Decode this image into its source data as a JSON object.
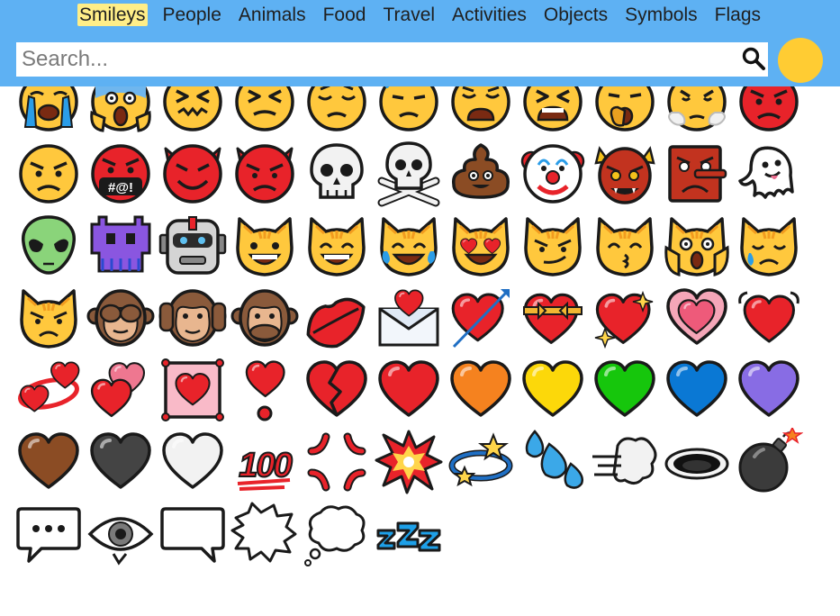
{
  "tabs": [
    "Smileys",
    "People",
    "Animals",
    "Food",
    "Travel",
    "Activities",
    "Objects",
    "Symbols",
    "Flags"
  ],
  "active_tab": "Smileys",
  "search": {
    "placeholder": "Search..."
  },
  "colors": {
    "header": "#5eb1f3",
    "active_tab": "#ffee88",
    "skin_tone": "#ffcc33"
  },
  "emojis": [
    [
      "loudly-crying-face",
      "face-screaming-in-fear",
      "confounded-face",
      "persevering-face",
      "disappointed-face",
      "downcast-face-with-sweat",
      "weary-face",
      "tired-face",
      "yawning-face",
      "face-with-steam-from-nose",
      "pouting-face"
    ],
    [
      "angry-face",
      "face-with-symbols-on-mouth",
      "smiling-face-with-horns",
      "angry-face-with-horns",
      "skull",
      "skull-and-crossbones",
      "pile-of-poo",
      "clown-face",
      "ogre",
      "goblin",
      "ghost"
    ],
    [
      "alien",
      "alien-monster",
      "robot",
      "grinning-cat",
      "grinning-cat-with-smiling-eyes",
      "cat-with-tears-of-joy",
      "smiling-cat-with-heart-eyes",
      "cat-with-wry-smile",
      "kissing-cat",
      "weary-cat",
      "crying-cat"
    ],
    [
      "pouting-cat",
      "see-no-evil-monkey",
      "hear-no-evil-monkey",
      "speak-no-evil-monkey",
      "kiss-mark",
      "love-letter",
      "heart-with-arrow",
      "heart-with-ribbon",
      "sparkling-heart",
      "growing-heart",
      "beating-heart"
    ],
    [
      "revolving-hearts",
      "two-hearts",
      "heart-decoration",
      "heart-exclamation",
      "broken-heart",
      "red-heart",
      "orange-heart",
      "yellow-heart",
      "green-heart",
      "blue-heart",
      "purple-heart"
    ],
    [
      "brown-heart",
      "black-heart",
      "white-heart",
      "hundred-points",
      "anger-symbol",
      "collision",
      "dizzy",
      "sweat-droplets",
      "dashing-away",
      "hole",
      "bomb"
    ],
    [
      "speech-balloon",
      "eye-in-speech-bubble",
      "left-speech-bubble",
      "right-anger-bubble",
      "thought-balloon",
      "zzz"
    ]
  ],
  "hundred_text": "100",
  "symbols_text": "#@!"
}
